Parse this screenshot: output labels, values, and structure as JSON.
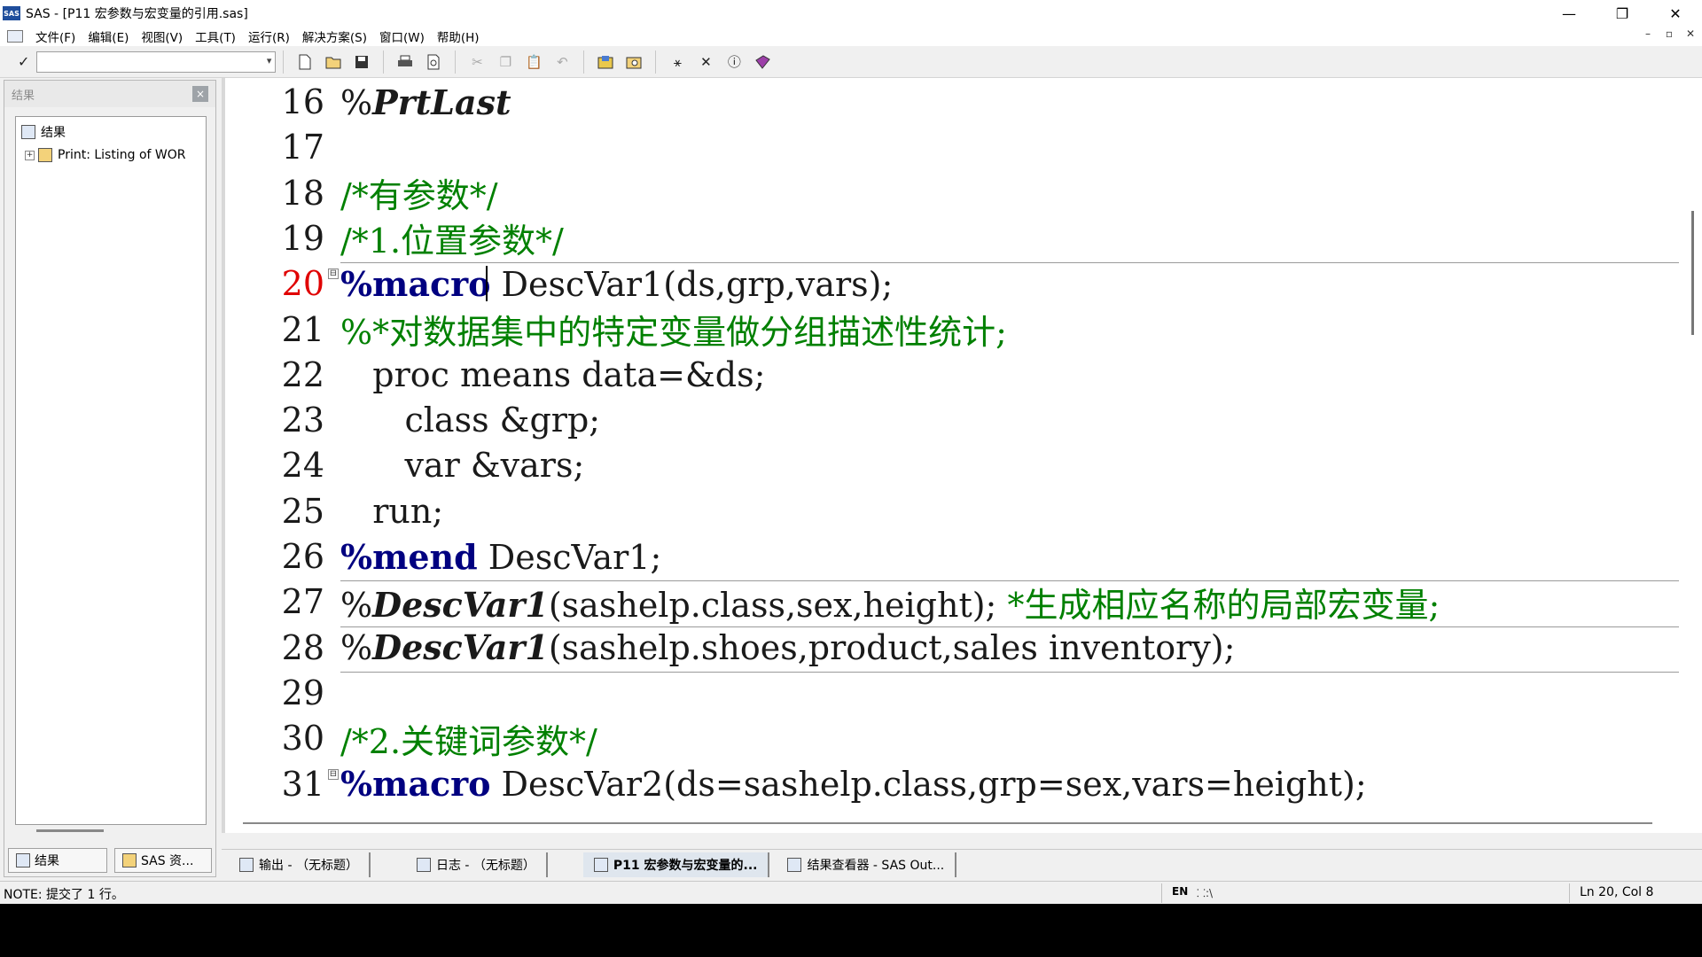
{
  "window": {
    "title": "SAS - [P11 宏参数与宏变量的引用.sas]",
    "app_icon_text": "SAS",
    "minimize": "—",
    "restore": "❐",
    "close": "✕"
  },
  "menu": {
    "items": [
      "文件(F)",
      "编辑(E)",
      "视图(V)",
      "工具(T)",
      "运行(R)",
      "解决方案(S)",
      "窗口(W)",
      "帮助(H)"
    ],
    "mdi_minimize": "–",
    "mdi_restore": "▫",
    "mdi_close": "✕"
  },
  "toolbar": {
    "command_value": "",
    "check": "✓",
    "dropdown_arrow": "▾"
  },
  "results_pane": {
    "title": "结果",
    "close": "×",
    "tree": [
      {
        "label": "结果"
      },
      {
        "label": "Print:  Listing of WOR"
      }
    ],
    "tabs": [
      "结果",
      "SAS 资..."
    ]
  },
  "editor": {
    "current_line": 20,
    "lines": [
      {
        "num": "16",
        "segments": [
          {
            "t": "%",
            "c": "plain"
          },
          {
            "t": "PrtLast",
            "c": "mc"
          }
        ]
      },
      {
        "num": "17",
        "segments": []
      },
      {
        "num": "18",
        "segments": [
          {
            "t": "/*有参数*/",
            "c": "cm"
          }
        ]
      },
      {
        "num": "19",
        "segments": [
          {
            "t": "/*1.位置参数*/",
            "c": "cm"
          }
        ]
      },
      {
        "num": "20",
        "segments": [
          {
            "t": "%macro",
            "c": "kw"
          },
          {
            "t": " DescVar1(ds,grp,vars);",
            "c": "plain"
          }
        ]
      },
      {
        "num": "21",
        "segments": [
          {
            "t": "%*对数据集中的特定变量做分组描述性统计;",
            "c": "cm"
          }
        ]
      },
      {
        "num": "22",
        "segments": [
          {
            "t": "   proc means data=&ds;",
            "c": "plain"
          }
        ]
      },
      {
        "num": "23",
        "segments": [
          {
            "t": "      class &grp;",
            "c": "plain"
          }
        ]
      },
      {
        "num": "24",
        "segments": [
          {
            "t": "      var &vars;",
            "c": "plain"
          }
        ]
      },
      {
        "num": "25",
        "segments": [
          {
            "t": "   run;",
            "c": "plain"
          }
        ]
      },
      {
        "num": "26",
        "segments": [
          {
            "t": "%mend",
            "c": "kw"
          },
          {
            "t": " DescVar1;",
            "c": "plain"
          }
        ]
      },
      {
        "num": "27",
        "segments": [
          {
            "t": "%",
            "c": "plain"
          },
          {
            "t": "DescVar1",
            "c": "mc"
          },
          {
            "t": "(sashelp.class,sex,height); ",
            "c": "plain"
          },
          {
            "t": "*生成相应名称的局部宏变量;",
            "c": "cm"
          }
        ]
      },
      {
        "num": "28",
        "segments": [
          {
            "t": "%",
            "c": "plain"
          },
          {
            "t": "DescVar1",
            "c": "mc"
          },
          {
            "t": "(sashelp.shoes,product,sales inventory);",
            "c": "plain"
          }
        ]
      },
      {
        "num": "29",
        "segments": []
      },
      {
        "num": "30",
        "segments": [
          {
            "t": "/*2.关键词参数*/",
            "c": "cm"
          }
        ]
      },
      {
        "num": "31",
        "segments": [
          {
            "t": "%macro",
            "c": "kw"
          },
          {
            "t": " DescVar2(ds=sashelp.class,grp=sex,vars=height);",
            "c": "plain"
          }
        ]
      }
    ],
    "fold_marker": "⊟"
  },
  "window_tabs": [
    {
      "label": "输出 - （无标题）",
      "active": false
    },
    {
      "label": "日志 - （无标题）",
      "active": false
    },
    {
      "label": "P11 宏参数与宏变量的...",
      "active": true
    },
    {
      "label": "结果查看器 - SAS Out...",
      "active": false
    }
  ],
  "statusbar": {
    "note": "NOTE: 提交了 1 行。",
    "ime": "EN",
    "ime_extra": "⸬:\\",
    "position": "Ln 20, Col 8"
  }
}
